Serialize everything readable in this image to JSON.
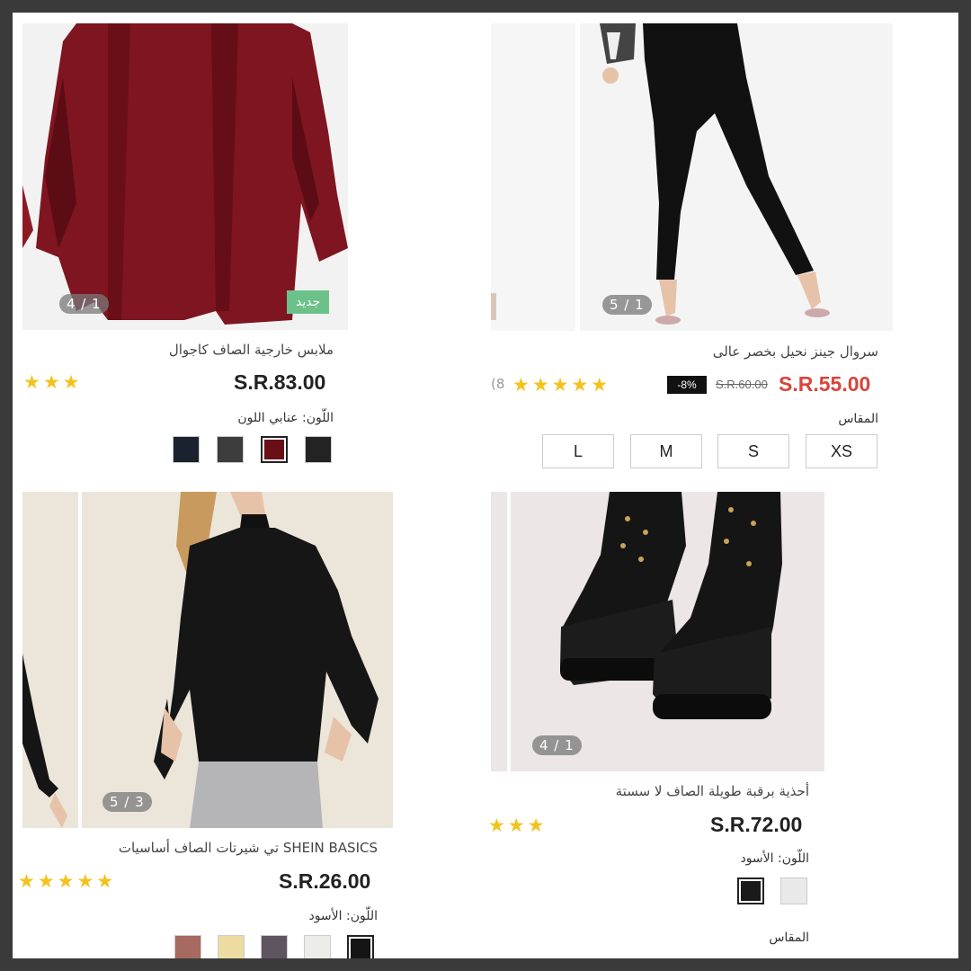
{
  "products": {
    "cardigan": {
      "counter": "4 / 1",
      "badge": "جديد",
      "title": "ملابس خارجية الصاف كاجوال",
      "price": "S.R.83.00",
      "stars": "★★★",
      "color_label": "اللّون: عنابي اللون",
      "swatches": [
        "#1a2230",
        "#3c3c3c",
        "#6b0f16",
        "#232323"
      ],
      "selected_swatch": 2
    },
    "jeans": {
      "counter": "5 / 1",
      "title": "سروال جينز نحيل بخصر عالى",
      "price": "S.R.55.00",
      "old_price": "S.R.60.00",
      "discount": "-8%",
      "stars": "★★★★★",
      "review_count": "(8",
      "size_label": "المقاس",
      "sizes": [
        "XS",
        "S",
        "M",
        "L"
      ]
    },
    "turtleneck": {
      "counter": "5 / 3",
      "title": "SHEIN BASICS تي شيرتات الصاف أساسيات",
      "price": "S.R.26.00",
      "stars": "★★★★★",
      "color_label": "اللّون: الأسود",
      "swatches": [
        "#a66b5e",
        "#ecdca2",
        "#5e5560",
        "#ecece8",
        "#151515"
      ],
      "selected_swatch": 4
    },
    "boots": {
      "counter": "4 / 1",
      "title": "أحذية برقبة طويلة الصاف لا سستة",
      "price": "S.R.72.00",
      "stars": "★★★",
      "color_label": "اللّون: الأسود",
      "swatches": [
        "#1a1a1a",
        "#e9e9e9"
      ],
      "selected_swatch": 0,
      "size_label": "المقاس"
    }
  },
  "colors": {
    "star": "#f4c21c",
    "sale_price": "#d9443a",
    "new_badge": "#6cc18a",
    "discount_bg": "#111111"
  }
}
